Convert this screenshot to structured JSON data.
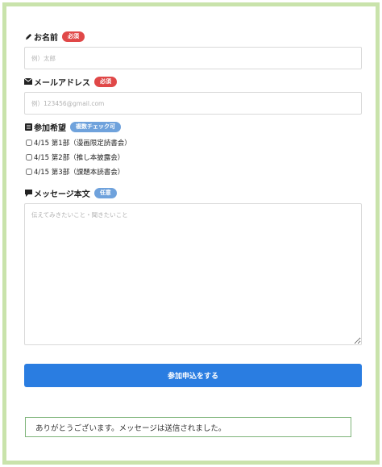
{
  "form": {
    "name": {
      "label": "お名前",
      "badge": "必須",
      "placeholder": "例）太郎"
    },
    "email": {
      "label": "メールアドレス",
      "badge": "必須",
      "placeholder": "例）123456@gmail.com"
    },
    "attendance": {
      "label": "参加希望",
      "badge": "複数チェック可",
      "options": [
        "4/15 第1部（漫画限定読書会）",
        "4/15 第2部（推し本披露会）",
        "4/15 第3部（課題本読書会）"
      ]
    },
    "message": {
      "label": "メッセージ本文",
      "badge": "任意",
      "placeholder": "伝えてみきたいこと・聞きたいこと"
    },
    "submit_label": "参加申込をする"
  },
  "confirmation": "ありがとうございます。メッセージは送信されました。",
  "colors": {
    "frame_border": "#c9e3ab",
    "required_badge": "#e04848",
    "info_badge": "#6fa2dc",
    "submit_button": "#2a7de1",
    "confirmation_border": "#7fb47a"
  },
  "icons": {
    "name": "pencil-icon",
    "email": "envelope-icon",
    "attendance": "list-icon",
    "message": "comment-icon"
  }
}
